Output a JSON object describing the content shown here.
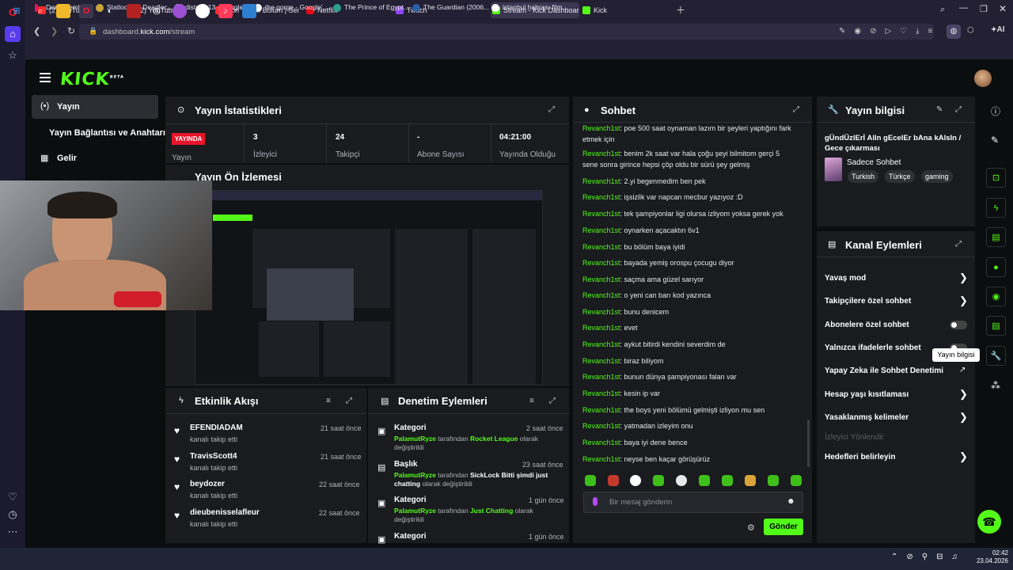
{
  "browser": {
    "tabs": [
      {
        "label": "(2) YouTube",
        "color": "#ff2d2d"
      },
      {
        "label": "(2) YouTube",
        "color": "#ff2d2d"
      },
      {
        "label": "Son Yaz 4. Bölüm | Sen Ağ",
        "color": "#ff2d2d"
      },
      {
        "label": "Netflix",
        "color": "#e50914"
      },
      {
        "label": "Twitch",
        "color": "#9146ff"
      },
      {
        "label": "Stream - Kick Dashboard",
        "color": "#53fc18"
      },
      {
        "label": "Kick",
        "color": "#53fc18"
      }
    ],
    "url_prefix": "dashboard.",
    "url_host": "kick.com",
    "url_path": "/stream",
    "bookmarks": [
      "Ders İşlemlerim",
      "Statlocker - Deadloc...",
      "districk 13 - Google'...",
      "the gorge - Google'...",
      "The Prince of Egypt...",
      "The Guardian (2006...",
      "istanbul habrası film..."
    ],
    "ai_label": "AI"
  },
  "kick": {
    "logo": "KICK",
    "logo_beta": "BETA",
    "nav": {
      "stream": "Yayın",
      "connection": "Yayın Bağlantısı ve Anahtarı",
      "income": "Gelir"
    },
    "stats": {
      "title": "Yayın İstatistikleri",
      "live_badge": "YAYINDA",
      "live_label": "Yayın",
      "items": [
        {
          "value": "3",
          "label": "İzleyici"
        },
        {
          "value": "24",
          "label": "Takipçi"
        },
        {
          "value": "-",
          "label": "Abone Sayısı"
        },
        {
          "value": "04:21:00",
          "label": "Yayında Olduğu"
        }
      ]
    },
    "preview": {
      "title": "Yayın Ön İzlemesi"
    },
    "activity": {
      "title": "Etkinlik Akışı",
      "items": [
        {
          "name": "EFENDIADAM",
          "desc": "kanalı takip etti",
          "time": "21 saat önce"
        },
        {
          "name": "TravisScott4",
          "desc": "kanalı takip etti",
          "time": "21 saat önce"
        },
        {
          "name": "beydozer",
          "desc": "kanalı takip etti",
          "time": "22 saat önce"
        },
        {
          "name": "dieubenisselafleur",
          "desc": "kanalı takip etti",
          "time": "22 saat önce"
        }
      ]
    },
    "moderation": {
      "title": "Denetim Eylemleri",
      "items": [
        {
          "title": "Kategori",
          "time": "2 saat önce",
          "user": "PalamutRyze",
          "mid": "tarafından",
          "target": "Rocket League",
          "suffix": "olarak",
          "suffix2": "değiştirildi"
        },
        {
          "title": "Başlık",
          "time": "23 saat önce",
          "user": "PalamutRyze",
          "mid": "tarafından",
          "target": "SickLock Bitti şimdi just",
          "target2": "chatting",
          "suffix": "olarak değiştirildi"
        },
        {
          "title": "Kategori",
          "time": "1 gün önce",
          "user": "PalamutRyze",
          "mid": "tarafından",
          "target": "Just Chatting",
          "suffix": "olarak",
          "suffix2": "değiştirildi"
        },
        {
          "title": "Kategori",
          "time": "1 gün önce"
        }
      ]
    },
    "chat": {
      "title": "Sohbet",
      "messages": [
        {
          "user": "Revanch1st",
          "text": ": poe 500 saat oynaman lazım bir şeyleri yaptığını fark",
          "text2": "etmek için"
        },
        {
          "user": "Revanch1st",
          "text": ": benim 2k saat var hala çoğu şeyi bilmitom gerçi 5",
          "text2": "sene sonra girince hepsi çöp oldu bir sürü şey gelmiş"
        },
        {
          "user": "Revanch1st",
          "text": ": 2.yi begenmedim ben pek"
        },
        {
          "user": "Revanch1st",
          "text": ": işsizlik var napcan mecbur yazıyoz :D"
        },
        {
          "user": "Revanch1st",
          "text": ": tek şampiyonlar ligi olursa izliyom yoksa gerek yok"
        },
        {
          "user": "Revanch1st",
          "text": ": oynarken açacaktın 6v1"
        },
        {
          "user": "Revanch1st",
          "text": ": bu bölüm baya iyidi"
        },
        {
          "user": "Revanch1st",
          "text": ": bayada yemiş orospu çocugu diyor"
        },
        {
          "user": "Revanch1st",
          "text": ": saçma ama güzel sarıyor"
        },
        {
          "user": "Revanch1st",
          "text": ": o yeni can barı kod yazınca"
        },
        {
          "user": "Revanch1st",
          "text": ": bunu denicem"
        },
        {
          "user": "Revanch1st",
          "text": ": evet"
        },
        {
          "user": "Revanch1st",
          "text": ": aykut bitirdi kendini severdim de"
        },
        {
          "user": "Revanch1st",
          "text": ": biraz biliyom"
        },
        {
          "user": "Revanch1st",
          "text": ": bunun dünya şampiyonası falan var"
        },
        {
          "user": "Revanch1st",
          "text": ": kesin ip var"
        },
        {
          "user": "Revanch1st",
          "text": ": the boys yeni bölümü gelmişti izliyon mu sen"
        },
        {
          "user": "Revanch1st",
          "text": ": yatmadan izleyim onu"
        },
        {
          "user": "Revanch1st",
          "text": ": baya iyi dene bence"
        },
        {
          "user": "Revanch1st",
          "text": ": neyse ben kaçar görüşürüz"
        }
      ],
      "placeholder": "Bir mesaj gönderin",
      "send": "Gönder"
    },
    "stream_info": {
      "title": "Yayın bilgisi",
      "stream_title": "gÜndÜzlErİ Alln gEcelEr bAna kAlsIn /",
      "stream_title2": "Gece çıkarması",
      "mode": "Sadece Sohbet",
      "tags": [
        "Turkish",
        "Türkçe",
        "gaming"
      ]
    },
    "channel_actions": {
      "title": "Kanal Eylemleri",
      "items": [
        {
          "label": "Yavaş mod",
          "kind": "chevron"
        },
        {
          "label": "Takipçilere özel sohbet",
          "kind": "chevron"
        },
        {
          "label": "Abonelere özel sohbet",
          "kind": "toggle"
        },
        {
          "label": "Yalnızca ifadelerle sohbet",
          "kind": "toggle"
        },
        {
          "label": "Yapay Zeka ile Sohbet Denetimi",
          "kind": "external"
        },
        {
          "label": "Hesap yaşı kısıtlaması",
          "kind": "chevron"
        },
        {
          "label": "Yasaklanmış kelimeler",
          "kind": "chevron"
        },
        {
          "label": "İzleyici Yönlendir",
          "kind": "disabled"
        },
        {
          "label": "Hedefleri belirleyin",
          "kind": "chevron"
        }
      ]
    },
    "tooltip": "Yayın bilgisi"
  },
  "taskbar": {
    "time": "02:42",
    "date": "23.04.2026"
  },
  "colors": {
    "accent": "#53fc18",
    "panel": "#191b1f",
    "bg": "#0b0e0f",
    "live": "#e8142a"
  }
}
